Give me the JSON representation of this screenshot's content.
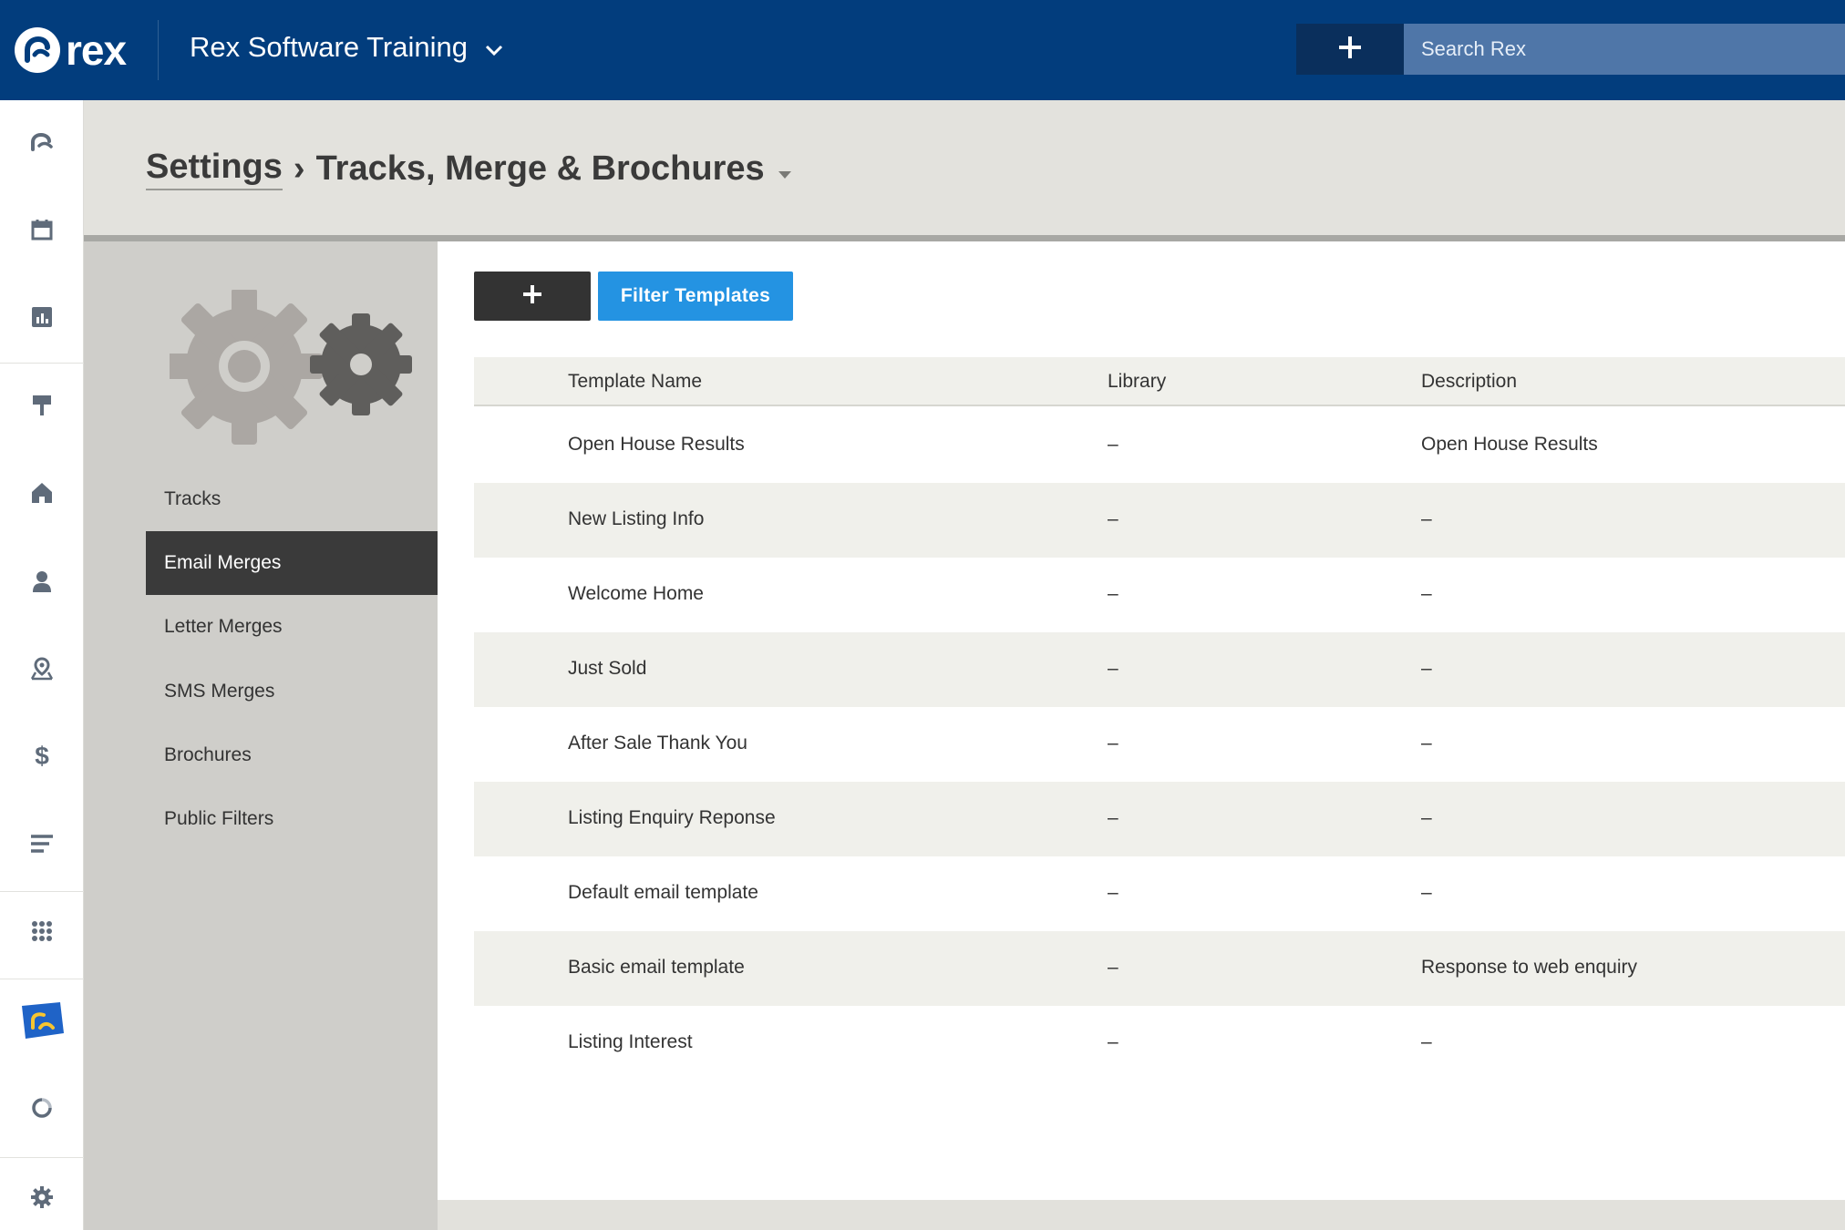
{
  "topbar": {
    "logo_text": "rex",
    "account_name": "Rex Software Training",
    "search_placeholder": "Search Rex",
    "brand_color": "#023d7d"
  },
  "rail": {
    "icons": [
      "rex-home-icon",
      "calendar-icon",
      "reports-icon",
      "listings-sign-icon",
      "properties-icon",
      "contacts-icon",
      "map-pin-icon",
      "dollar-icon",
      "feed-lines-icon",
      "apps-grid-icon",
      "rex-rewards-icon",
      "refresh-icon",
      "gear-icon"
    ]
  },
  "breadcrumb": {
    "root": "Settings",
    "separator": "›",
    "current": "Tracks, Merge & Brochures"
  },
  "subnav": {
    "items": [
      {
        "label": "Tracks",
        "active": false
      },
      {
        "label": "Email Merges",
        "active": true
      },
      {
        "label": "Letter Merges",
        "active": false
      },
      {
        "label": "SMS Merges",
        "active": false
      },
      {
        "label": "Brochures",
        "active": false
      },
      {
        "label": "Public Filters",
        "active": false
      }
    ]
  },
  "toolbar": {
    "filter_label": "Filter Templates",
    "accent_color": "#2493e2"
  },
  "table": {
    "columns": [
      "Template Name",
      "Library",
      "Description"
    ],
    "rows": [
      [
        "Open House Results",
        "–",
        "Open House Results"
      ],
      [
        "New Listing Info",
        "–",
        "–"
      ],
      [
        "Welcome Home",
        "–",
        "–"
      ],
      [
        "Just Sold",
        "–",
        "–"
      ],
      [
        "After Sale Thank You",
        "–",
        "–"
      ],
      [
        "Listing Enquiry Reponse",
        "–",
        "–"
      ],
      [
        "Default email template",
        "–",
        "–"
      ],
      [
        "Basic email template",
        "–",
        "Response to web enquiry"
      ],
      [
        "Listing Interest",
        "–",
        "–"
      ]
    ]
  }
}
